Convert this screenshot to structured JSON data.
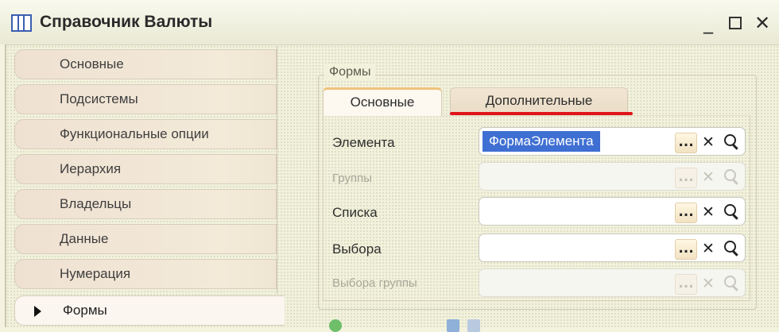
{
  "window": {
    "title": "Справочник Валюты",
    "buttons": {
      "minimize": "_",
      "close": "✕"
    }
  },
  "nav": {
    "items": [
      {
        "label": "Основные"
      },
      {
        "label": "Подсистемы"
      },
      {
        "label": "Функциональные опции"
      },
      {
        "label": "Иерархия"
      },
      {
        "label": "Владельцы"
      },
      {
        "label": "Данные"
      },
      {
        "label": "Нумерация"
      },
      {
        "label": "Формы",
        "active": true
      }
    ]
  },
  "forms": {
    "group_title": "Формы",
    "tabs": [
      {
        "label": "Основные",
        "active": true
      },
      {
        "label": "Дополнительные"
      }
    ],
    "fields": [
      {
        "label": "Элемента",
        "value": "ФормаЭлемента",
        "enabled": true
      },
      {
        "label": "Группы",
        "value": "",
        "enabled": false
      },
      {
        "label": "Списка",
        "value": "",
        "enabled": true
      },
      {
        "label": "Выбора",
        "value": "",
        "enabled": true
      },
      {
        "label": "Выбора группы",
        "value": "",
        "enabled": false
      }
    ],
    "field_buttons": {
      "select": "...",
      "clear": "✕"
    }
  },
  "colors": {
    "accent_underline": "#e0141a",
    "selection": "#3f6fd2",
    "active_tab_top": "#f0c27a"
  }
}
